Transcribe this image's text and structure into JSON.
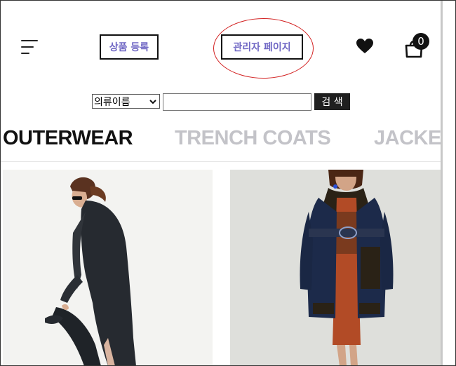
{
  "header": {
    "menu_icon": "hamburger-menu-icon",
    "register_label": "상품 등록",
    "admin_label": "관리자 페이지",
    "wishlist_icon": "heart-icon",
    "cart_icon": "shopping-bag-icon",
    "cart_count": "0",
    "annotation_color": "#d21f1f"
  },
  "search": {
    "selected_option": "의류이름",
    "input_value": "",
    "button_label": "검 색"
  },
  "categories": [
    {
      "label": "OUTERWEAR",
      "active": true
    },
    {
      "label": "TRENCH COATS",
      "active": false
    },
    {
      "label": "JACKE",
      "active": false
    }
  ],
  "products": [
    {
      "image": "woman-in-long-black-coat-photo"
    },
    {
      "image": "woman-in-navy-shearling-coat-photo"
    }
  ],
  "colors": {
    "button_text": "#6f67c4",
    "active_category": "#111111",
    "inactive_category": "#c3c3c8"
  }
}
